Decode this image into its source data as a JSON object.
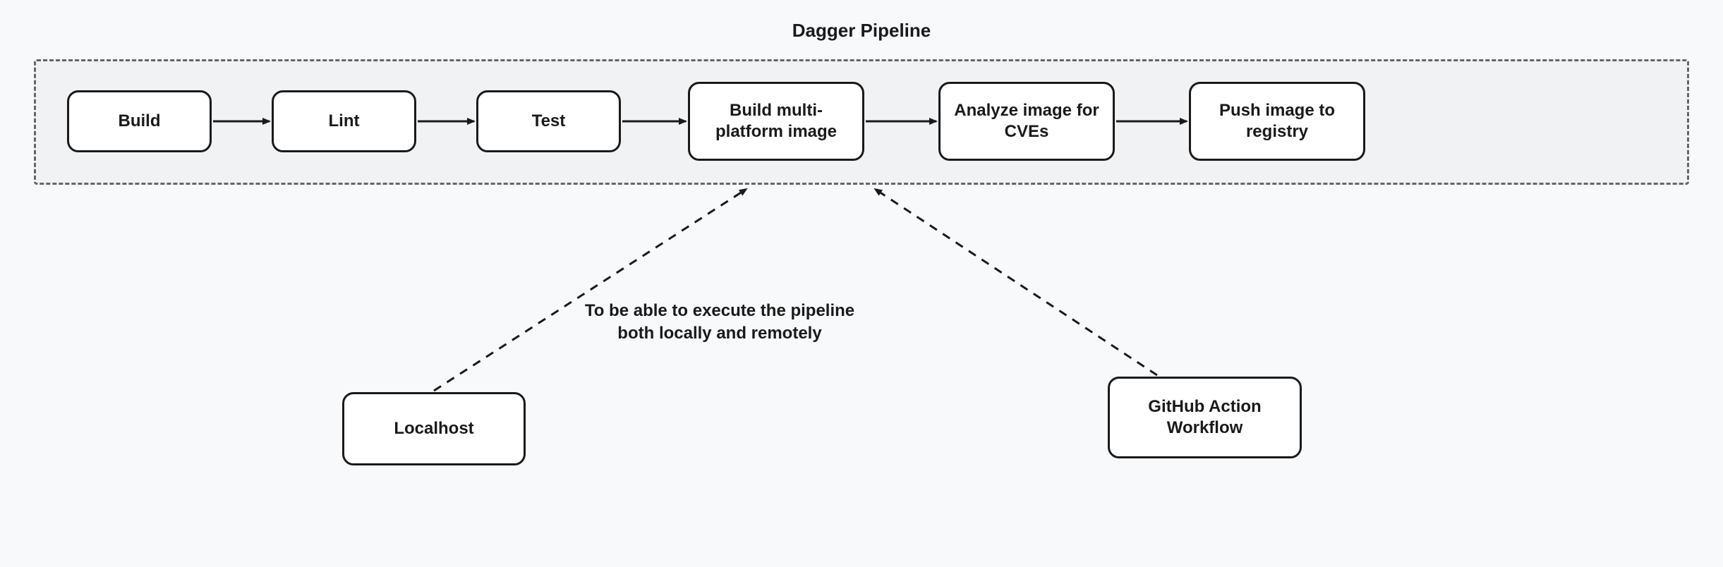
{
  "title": "Dagger Pipeline",
  "pipeline": {
    "steps": [
      {
        "label": "Build"
      },
      {
        "label": "Lint"
      },
      {
        "label": "Test"
      },
      {
        "label": "Build multi-platform image"
      },
      {
        "label": "Analyze image for CVEs"
      },
      {
        "label": "Push image to registry"
      }
    ]
  },
  "caption": {
    "line1": "To be able to execute the pipeline",
    "line2": "both locally and remotely"
  },
  "sources": [
    {
      "label": "Localhost"
    },
    {
      "label": "GitHub Action Workflow"
    }
  ]
}
